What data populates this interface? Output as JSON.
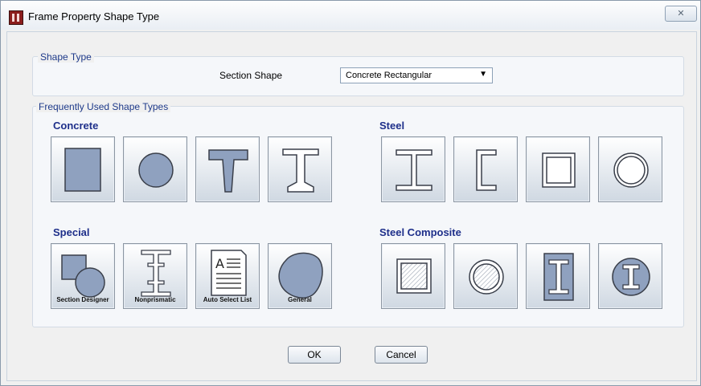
{
  "window": {
    "title": "Frame Property Shape Type",
    "close_glyph": "✕"
  },
  "shape_type": {
    "group_title": "Shape Type",
    "section_shape_label": "Section Shape",
    "section_shape_value": "Concrete Rectangular"
  },
  "frequent": {
    "group_title": "Frequently Used Shape Types",
    "categories": {
      "concrete": "Concrete",
      "steel": "Steel",
      "special": "Special",
      "steel_composite": "Steel Composite"
    },
    "special_captions": [
      "Section Designer",
      "Nonprismatic",
      "Auto Select List",
      "General"
    ]
  },
  "buttons": {
    "ok": "OK",
    "cancel": "Cancel"
  },
  "colors": {
    "shape_fill": "#8fa1bf",
    "shape_stroke": "#3a3f4a",
    "category_text": "#1e2f8a"
  }
}
